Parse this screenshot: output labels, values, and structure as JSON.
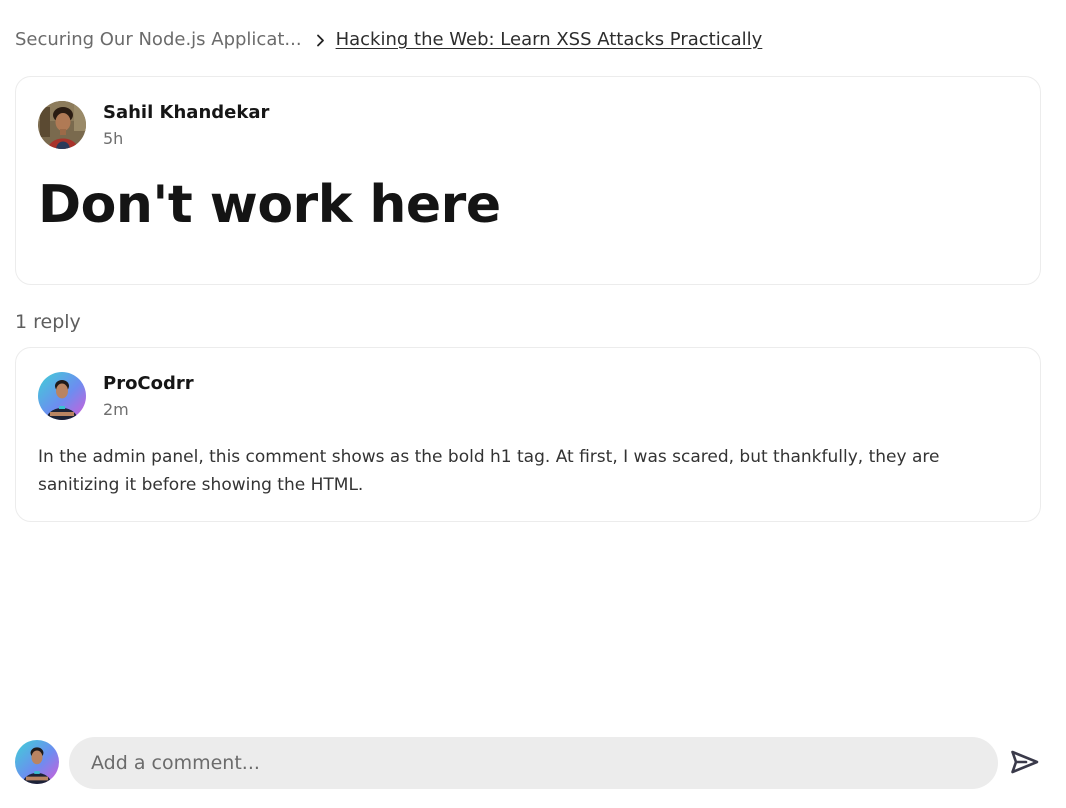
{
  "breadcrumb": {
    "parent": "Securing Our Node.js Applicat...",
    "current": "Hacking the Web: Learn XSS Attacks Practically",
    "separator_icon": "chevron-right-icon"
  },
  "post": {
    "author_name": "Sahil Khandekar",
    "time": "5h",
    "heading": "Don't work here",
    "avatar_icon": "user-avatar"
  },
  "replies": {
    "count_label": "1 reply",
    "items": [
      {
        "author_name": "ProCodrr",
        "time": "2m",
        "text": "In the admin panel, this comment shows as the bold h1 tag. At first, I was scared, but thankfully, they are sanitizing it before showing the HTML.",
        "avatar_icon": "user-avatar"
      }
    ]
  },
  "comment": {
    "placeholder": "Add a comment...",
    "value": "",
    "send_icon": "send-icon"
  },
  "colors": {
    "card_border": "#ececec",
    "input_bg": "#ececec",
    "muted_text": "#6b6b6b",
    "send_icon": "#3a3a4a"
  }
}
